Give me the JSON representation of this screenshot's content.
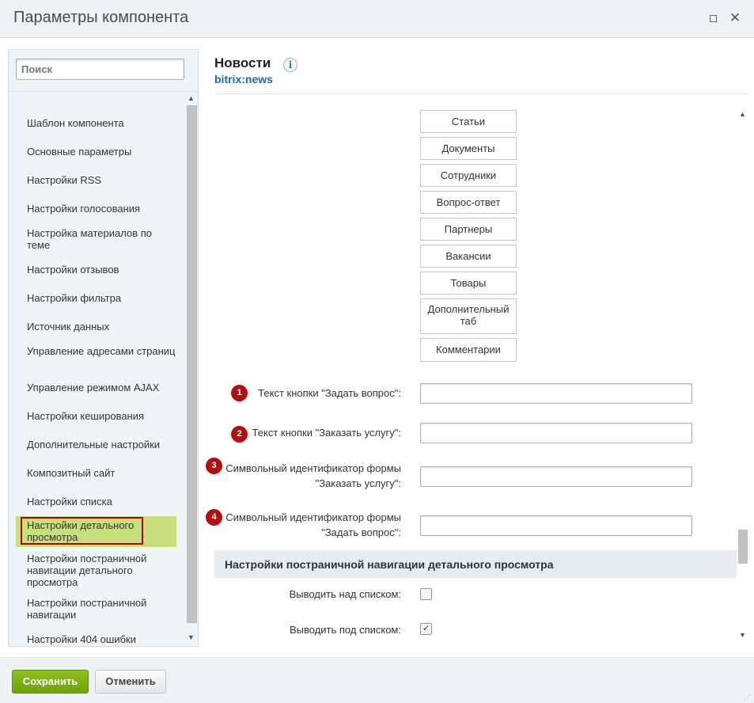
{
  "window": {
    "title": "Параметры компонента",
    "maximize_glyph": "",
    "close_glyph": "✕"
  },
  "sidebar": {
    "search_placeholder": "Поиск",
    "items": [
      {
        "label": "Шаблон компонента"
      },
      {
        "label": "Основные параметры"
      },
      {
        "label": "Настройки RSS"
      },
      {
        "label": "Настройки голосования"
      },
      {
        "label": "Настройка материалов по теме"
      },
      {
        "label": "Настройки отзывов"
      },
      {
        "label": "Настройки фильтра"
      },
      {
        "label": "Источник данных"
      },
      {
        "label": "Управление адресами страниц"
      },
      {
        "label": "Управление режимом AJAX"
      },
      {
        "label": "Настройки кеширования"
      },
      {
        "label": "Дополнительные настройки"
      },
      {
        "label": "Композитный сайт"
      },
      {
        "label": "Настройки списка"
      },
      {
        "label": "Настройки детального просмотра",
        "active": true
      },
      {
        "label": "Настройки постраничной навигации детального просмотра"
      },
      {
        "label": "Настройки постраничной навигации"
      },
      {
        "label": "Настройки 404 ошибки"
      }
    ]
  },
  "main": {
    "title": "Новости",
    "info_icon": "i",
    "subtitle": "bitrix:news",
    "tabs": [
      {
        "label": "Статьи"
      },
      {
        "label": "Документы"
      },
      {
        "label": "Сотрудники"
      },
      {
        "label": "Вопрос-ответ"
      },
      {
        "label": "Партнеры"
      },
      {
        "label": "Вакансии"
      },
      {
        "label": "Товары"
      },
      {
        "label": "Дополнительный таб"
      },
      {
        "label": "Комментарии"
      }
    ],
    "fields": [
      {
        "badge": "1",
        "label": "Текст кнопки \"Задать вопрос\":",
        "value": ""
      },
      {
        "badge": "2",
        "label": "Текст кнопки \"Заказать услугу\":",
        "value": ""
      },
      {
        "badge": "3",
        "label": "Символьный идентификатор формы \"Заказать услугу\":",
        "value": ""
      },
      {
        "badge": "4",
        "label": "Символьный идентификатор формы \"Задать вопрос\":",
        "value": ""
      }
    ],
    "section_title": "Настройки постраничной навигации детального просмотра",
    "checkboxes": [
      {
        "label": "Выводить над списком:",
        "checked": false
      },
      {
        "label": "Выводить под списком:",
        "checked": true
      }
    ]
  },
  "footer": {
    "save_label": "Сохранить",
    "cancel_label": "Отменить"
  },
  "colors": {
    "accent_green": "#7bb012",
    "active_item": "#c8df7e",
    "badge_red": "#b30f0f",
    "link_blue": "#2067b0"
  }
}
